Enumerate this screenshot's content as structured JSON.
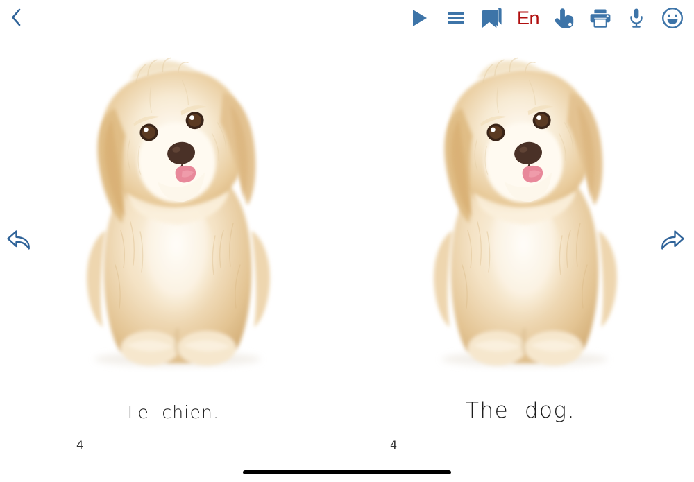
{
  "app": {
    "back_label": "‹",
    "home_indicator": true
  },
  "toolbar": {
    "items": [
      {
        "name": "play-icon",
        "label": "Play"
      },
      {
        "name": "menu-icon",
        "label": "Menu"
      },
      {
        "name": "bookmark-icon",
        "label": "Bookmarks"
      },
      {
        "name": "language-toggle",
        "label": "En"
      },
      {
        "name": "hand-pointer-icon",
        "label": "Touch mode"
      },
      {
        "name": "printer-icon",
        "label": "Print"
      },
      {
        "name": "microphone-icon",
        "label": "Record"
      },
      {
        "name": "smiley-icon",
        "label": "Feedback"
      }
    ],
    "language_current": "En",
    "language_color": "#b00f0f",
    "icon_color": "#3d74a8"
  },
  "navigation": {
    "prev_label": "Previous page",
    "next_label": "Next page",
    "arrow_color": "#2f6399"
  },
  "pages": [
    {
      "side": "left",
      "language": "French",
      "caption": "Le  chien.",
      "page_number": "4",
      "image_alt": "Havanese puppy sitting, cream and tan fur"
    },
    {
      "side": "right",
      "language": "English",
      "caption": "The  dog.",
      "page_number": "4",
      "image_alt": "Havanese puppy sitting, cream and tan fur"
    }
  ],
  "colors": {
    "background": "#ffffff",
    "text": "#1c1c1c",
    "fur_light": "#fdf4e6",
    "fur_mid": "#f0d9b0",
    "fur_tan": "#e0bc8a",
    "fur_dark": "#cfa469",
    "nose": "#4a3127",
    "tongue": "#e8889a"
  }
}
